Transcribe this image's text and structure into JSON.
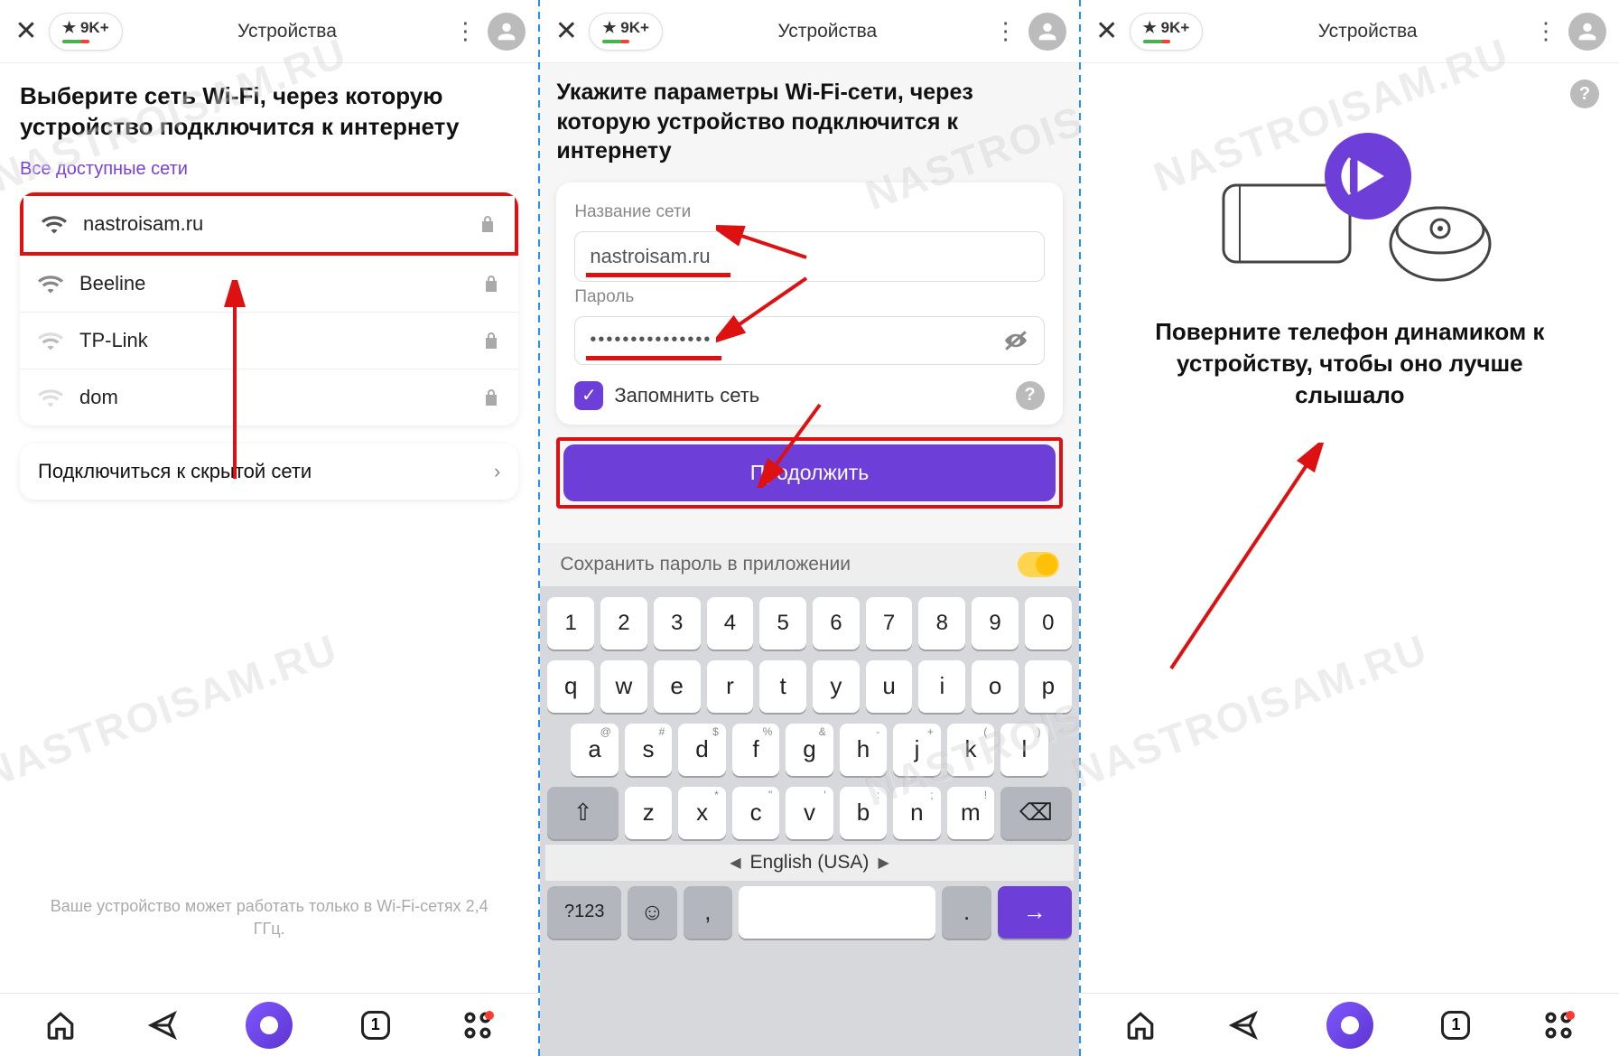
{
  "header": {
    "badge": "★ 9K+",
    "title": "Устройства"
  },
  "screen1": {
    "title": "Выберите сеть Wi-Fi, через которую устройство подключится к интернету",
    "all_networks": "Все доступные сети",
    "networks": [
      {
        "name": "nastroisam.ru",
        "strength": 3,
        "locked": true
      },
      {
        "name": "Beeline",
        "strength": 3,
        "locked": true
      },
      {
        "name": "TP-Link",
        "strength": 2,
        "locked": true
      },
      {
        "name": "dom",
        "strength": 1,
        "locked": true
      }
    ],
    "hidden": "Подключиться к скрытой сети",
    "footer": "Ваше устройство может работать только в Wi-Fi-сетях 2,4 ГГц."
  },
  "screen2": {
    "title": "Укажите параметры Wi-Fi-сети, через которую устройство подключится к интернету",
    "name_label": "Название сети",
    "name_value": "nastroisam.ru",
    "password_label": "Пароль",
    "password_mask": "•••••••••••••••",
    "remember": "Запомнить сеть",
    "continue": "Продолжить",
    "save_app": "Сохранить пароль в приложении",
    "keyboard": {
      "row1": [
        "1",
        "2",
        "3",
        "4",
        "5",
        "6",
        "7",
        "8",
        "9",
        "0"
      ],
      "row2": [
        "q",
        "w",
        "e",
        "r",
        "t",
        "y",
        "u",
        "i",
        "o",
        "p"
      ],
      "row3": [
        "a",
        "s",
        "d",
        "f",
        "g",
        "h",
        "j",
        "k",
        "l"
      ],
      "row4": [
        "z",
        "x",
        "c",
        "v",
        "b",
        "n",
        "m"
      ],
      "sym": "?123",
      "lang": "English (USA)",
      "row3_hints": [
        "@",
        "#",
        "$",
        "%",
        "&",
        "-",
        "+",
        "(",
        ")"
      ],
      "row4_hints": [
        "",
        "*",
        "\"",
        "'",
        ":",
        ";",
        "!",
        "?"
      ]
    }
  },
  "screen3": {
    "title": "Поверните телефон динамиком к устройству, чтобы оно лучше слышало"
  },
  "nav": {
    "tab_count": "1"
  },
  "watermark": "NASTROISAM.RU"
}
